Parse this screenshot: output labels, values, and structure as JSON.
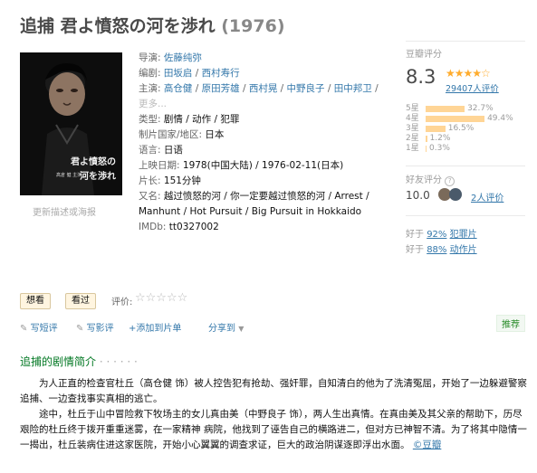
{
  "title": {
    "name": "追捕 君よ憤怒の河を渉れ",
    "year": "(1976)"
  },
  "poster": {
    "caption": "更新描述或海报",
    "jp_title_1": "君よ憤怒の",
    "jp_title_2": "河を渉れ",
    "credits": "高倉 健 主演"
  },
  "info": {
    "director_label": "导演:",
    "director": "佐藤纯弥",
    "writer_label": "编剧:",
    "writers": [
      "田坂启",
      "西村寿行"
    ],
    "cast_label": "主演:",
    "cast": [
      "高仓健",
      "原田芳雄",
      "西村晃",
      "中野良子",
      "田中邦卫"
    ],
    "cast_more": "更多...",
    "genre_label": "类型:",
    "genre": "剧情 / 动作 / 犯罪",
    "country_label": "制片国家/地区:",
    "country": "日本",
    "language_label": "语言:",
    "language": "日语",
    "release_label": "上映日期:",
    "release": "1978(中国大陆) / 1976-02-11(日本)",
    "runtime_label": "片长:",
    "runtime": "151分钟",
    "aka_label": "又名:",
    "aka": "越过愤怒的河 / 你一定要越过愤怒的河 / Arrest / Manhunt / Hot Pursuit / Big Pursuit in Hokkaido",
    "imdb_label": "IMDb:",
    "imdb": "tt0327002"
  },
  "rating": {
    "header": "豆瓣评分",
    "score": "8.3",
    "stars": "★★★★☆",
    "votes": "29407人评价",
    "bars": [
      {
        "label": "5星",
        "pct": "32.7%",
        "value": 32.7
      },
      {
        "label": "4星",
        "pct": "49.4%",
        "value": 49.4
      },
      {
        "label": "3星",
        "pct": "16.5%",
        "value": 16.5
      },
      {
        "label": "2星",
        "pct": "1.2%",
        "value": 1.2
      },
      {
        "label": "1星",
        "pct": "0.3%",
        "value": 0.3
      }
    ],
    "friends_header": "好友评分",
    "friends_score": "10.0",
    "friends_count": "2人评价",
    "better_1_prefix": "好于",
    "better_1_pct": "92%",
    "better_1_genre": "犯罪片",
    "better_2_prefix": "好于",
    "better_2_pct": "88%",
    "better_2_genre": "动作片"
  },
  "actions": {
    "want": "想看",
    "seen": "看过",
    "rate_label": "评价:",
    "rate_stars": "☆☆☆☆☆",
    "short_review": "写短评",
    "review": "写影评",
    "add_list": "+添加到片单",
    "share": "分享到",
    "recommend": "推荐"
  },
  "synopsis": {
    "heading": "追捕的剧情简介",
    "dots": "· · · · · ·",
    "p1": "为人正直的检查官杜丘（高仓健 饰）被人控告犯有抢劫、强奸罪，自知清白的他为了洗清冤屈，开始了一边躲避警察追捕、一边查找事实真相的逃亡。",
    "p2": "途中，杜丘于山中冒险救下牧场主的女儿真由美（中野良子 饰），两人生出真情。在真由美及其父亲的帮助下，历尽艰险的杜丘终于拨开重重迷雾，在一家精神 病院，他找到了诬告自己的横路进二，但对方已神智不清。为了将其中隐情一一揭出，杜丘装病住进这家医院，开始小心翼翼的调查求证，巨大的政治阴谋逐即浮出水面。",
    "source": "©豆瓣"
  },
  "colors": {
    "link": "#3377aa",
    "star": "#ffac2d",
    "bar": "#ffd596",
    "green": "#007722"
  }
}
